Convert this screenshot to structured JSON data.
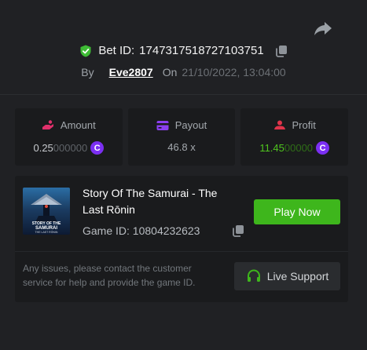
{
  "header": {
    "bet_id_label": "Bet ID:",
    "bet_id": "1747317518727103751",
    "by_label": "By",
    "username": "Eve2807",
    "on_label": "On",
    "datetime": "21/10/2022, 13:04:00"
  },
  "stats": {
    "amount": {
      "label": "Amount",
      "value_lit": "0.25",
      "value_dim": "000000",
      "currency_icon": "coin-icon"
    },
    "payout": {
      "label": "Payout",
      "value": "46.8 x"
    },
    "profit": {
      "label": "Profit",
      "value_lit": "11.45",
      "value_dim": "00000",
      "currency_icon": "coin-icon"
    }
  },
  "game": {
    "title": "Story Of The Samurai - The Last Rōnin",
    "id_text": "Game ID: 10804232623",
    "play_label": "Play Now",
    "thumb_text_1": "STORY OF THE",
    "thumb_text_2": "SAMURAI",
    "thumb_text_3": "THE LAST RŌNIN"
  },
  "footer": {
    "issues_text": "Any issues, please contact the customer service for help and provide the game ID.",
    "support_label": "Live Support"
  },
  "colors": {
    "background": "#202124",
    "card": "#1a1b1d",
    "accent_green": "#3eb61c",
    "profit_green": "#4fc41e",
    "coin_purple": "#7b2ff2",
    "amount_pink": "#e0306b",
    "payout_purple": "#8b3ff0",
    "profit_red": "#e0344a"
  }
}
